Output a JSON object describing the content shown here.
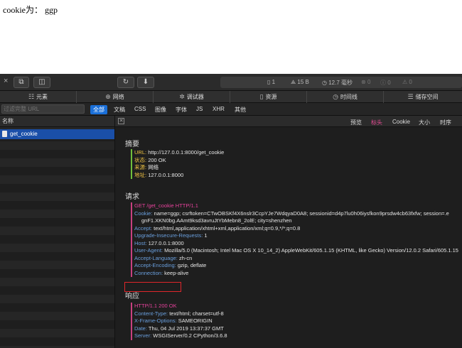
{
  "page": {
    "text": "cookie为： ggp"
  },
  "toolbar": {
    "close": "×",
    "reload_icon": "reload-icon",
    "download_icon": "download-icon",
    "resources": {
      "count": "1",
      "size": "15 B",
      "time": "12.7 毫秒",
      "errors": "0",
      "info": "0",
      "warnings": "0"
    }
  },
  "tabs": [
    {
      "label": "元素",
      "icon": "elements-icon"
    },
    {
      "label": "网络",
      "icon": "network-icon"
    },
    {
      "label": "调试器",
      "icon": "debugger-icon"
    },
    {
      "label": "资源",
      "icon": "resources-icon"
    },
    {
      "label": "时间线",
      "icon": "timeline-icon"
    },
    {
      "label": "储存空间",
      "icon": "storage-icon"
    }
  ],
  "filter": {
    "placeholder": "过滤完整 URL",
    "types": [
      "全部",
      "文稿",
      "CSS",
      "图像",
      "字体",
      "JS",
      "XHR",
      "其他"
    ],
    "active": "全部"
  },
  "sidebar": {
    "header": "名称",
    "request": "get_cookie"
  },
  "detail_tabs": {
    "items": [
      "预览",
      "标头",
      "Cookie",
      "大小",
      "时序"
    ],
    "active": "标头"
  },
  "summary": {
    "title": "摘要",
    "rows": [
      {
        "k": "URL:",
        "v": "http://127.0.0.1:8000/get_cookie"
      },
      {
        "k": "状态:",
        "v": "200 OK"
      },
      {
        "k": "来源:",
        "v": "网络"
      },
      {
        "k": "地址:",
        "v": "127.0.0.1:8000"
      }
    ]
  },
  "request": {
    "title": "请求",
    "line": "GET /get_cookie HTTP/1.1",
    "cookie_key": "Cookie:",
    "cookie_value": "name=ggp; csrftoken=CTwOBSKf4X6nslr3CcpYJe7WdqyaD0A8; sessionid=d4p7lu0h06iysfkon9prsdw4cb63fxfw; session=.e",
    "cookie_cont": "gnF1.XKN0bg.AAmt9ksd3avruJtYbMebn8_2olE; city=shenzhen",
    "headers": [
      {
        "k": "Accept:",
        "v": "text/html,application/xhtml+xml,application/xml;q=0.9,*/*;q=0.8"
      },
      {
        "k": "Upgrade-Insecure-Requests:",
        "v": "1"
      },
      {
        "k": "Host:",
        "v": "127.0.0.1:8000"
      },
      {
        "k": "User-Agent:",
        "v": "Mozilla/5.0 (Macintosh; Intel Mac OS X 10_14_2) AppleWebKit/605.1.15 (KHTML, like Gecko) Version/12.0.2 Safari/605.1.15"
      },
      {
        "k": "Accept-Language:",
        "v": "zh-cn"
      },
      {
        "k": "Accept-Encoding:",
        "v": "gzip, deflate"
      },
      {
        "k": "Connection:",
        "v": "keep-alive"
      }
    ]
  },
  "response": {
    "title": "响应",
    "line": "HTTP/1.1 200 OK",
    "headers": [
      {
        "k": "Content-Type:",
        "v": "text/html; charset=utf-8"
      },
      {
        "k": "X-Frame-Options:",
        "v": "SAMEORIGIN"
      },
      {
        "k": "Date:",
        "v": "Thu, 04 Jul 2019 13:37:37 GMT"
      },
      {
        "k": "Server:",
        "v": "WSGIServer/0.2 CPython/3.6.8"
      }
    ]
  },
  "colors": {
    "selected_row": "#1a4fa8",
    "active_filter": "#1a6fd8",
    "active_detail_tab": "#e24a92",
    "highlight_box": "#e0262b"
  }
}
